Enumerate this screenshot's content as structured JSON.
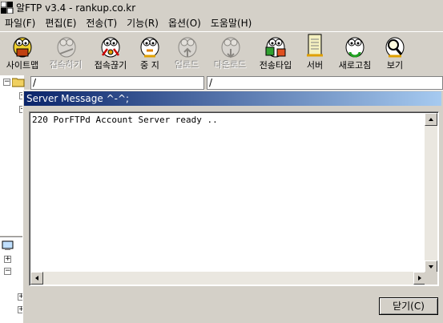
{
  "window": {
    "title": "알FTP v3.4 - rankup.co.kr"
  },
  "menu": [
    {
      "label": "파일(F)"
    },
    {
      "label": "편집(E)"
    },
    {
      "label": "전송(T)"
    },
    {
      "label": "기능(R)"
    },
    {
      "label": "옵션(O)"
    },
    {
      "label": "도움말(H)"
    }
  ],
  "toolbar": [
    {
      "label": "사이트맵",
      "icon": "site-map-icon",
      "enabled": true
    },
    {
      "label": "접속하기",
      "icon": "connect-icon",
      "enabled": false
    },
    {
      "label": "접속끊기",
      "icon": "disconnect-icon",
      "enabled": true
    },
    {
      "label": "중 지",
      "icon": "stop-icon",
      "enabled": true
    },
    {
      "label": "업로드",
      "icon": "upload-icon",
      "enabled": false
    },
    {
      "label": "다운로드",
      "icon": "download-icon",
      "enabled": false
    },
    {
      "label": "전송타입",
      "icon": "transfer-type-icon",
      "enabled": true
    },
    {
      "label": "서버",
      "icon": "server-icon",
      "enabled": true
    },
    {
      "label": "새로고침",
      "icon": "refresh-icon",
      "enabled": true
    },
    {
      "label": "보기",
      "icon": "view-icon",
      "enabled": true
    }
  ],
  "local_path": "/",
  "remote_path": "/",
  "dialog": {
    "title": "Server Message ^-^;",
    "message": "220 PorFTPd Account Server ready ..",
    "close_label": "닫기(C)"
  },
  "colors": {
    "title_gradient_start": "#0a246a",
    "title_gradient_end": "#a6caf0",
    "face": "#d4d0c8"
  }
}
